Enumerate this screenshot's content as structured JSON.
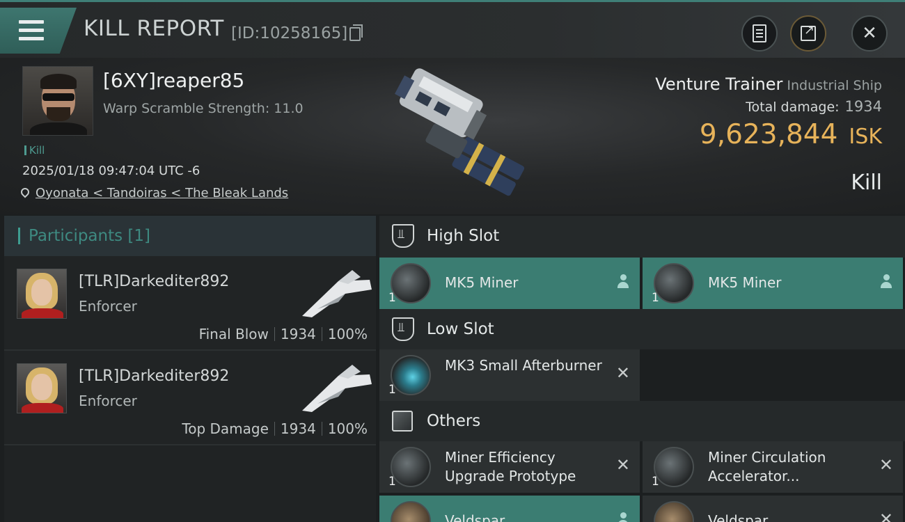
{
  "header": {
    "title": "KILL REPORT",
    "report_id": "[ID:10258165]"
  },
  "victim": {
    "name": "[6XY]reaper85",
    "warp_scramble": "Warp Scramble Strength: 11.0",
    "tag": "Kill",
    "timestamp": "2025/01/18 09:47:04 UTC -6",
    "location": "Oyonata < Tandoiras < The Bleak Lands"
  },
  "ship": {
    "name": "Venture Trainer",
    "class": "Industrial Ship",
    "total_damage_label": "Total damage:",
    "total_damage": "1934",
    "isk_value": "9,623,844",
    "isk_unit": "ISK",
    "result": "Kill"
  },
  "participants": {
    "header": "Participants [1]",
    "rows": [
      {
        "name": "[TLR]Darkediter892",
        "role": "Enforcer",
        "tag": "Final Blow",
        "damage": "1934",
        "percent": "100%"
      },
      {
        "name": "[TLR]Darkediter892",
        "role": "Enforcer",
        "tag": "Top Damage",
        "damage": "1934",
        "percent": "100%"
      }
    ]
  },
  "fitting": {
    "high_slot": {
      "label": "High Slot",
      "items": [
        {
          "name": "MK5 Miner",
          "qty": "1"
        },
        {
          "name": "MK5 Miner",
          "qty": "1"
        }
      ]
    },
    "low_slot": {
      "label": "Low Slot",
      "items": [
        {
          "name": "MK3 Small Afterburner",
          "qty": "1"
        }
      ]
    },
    "others": {
      "label": "Others",
      "items": [
        {
          "name": "Miner Efficiency Upgrade Prototype",
          "qty": "1"
        },
        {
          "name": "Miner Circulation Accelerator...",
          "qty": "1"
        },
        {
          "name": "Veldspar",
          "qty": ""
        },
        {
          "name": "Veldspar",
          "qty": ""
        }
      ]
    }
  },
  "colors": {
    "accent_teal": "#3b7d72",
    "isk_gold": "#e7b35a",
    "background": "#1c1f20"
  }
}
